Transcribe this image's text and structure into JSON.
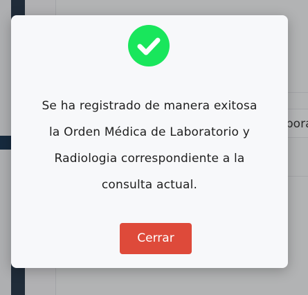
{
  "background": {
    "cell_text": "Laborator"
  },
  "dialog": {
    "icon": "check-circle-icon",
    "icon_color": "#19e65c",
    "message_lines": [
      "Se ha registrado de manera exitosa",
      "la Orden Médica de Laboratorio y",
      "Radiologia correspondiente a la",
      "consulta actual."
    ],
    "close_label": "Cerrar",
    "close_color": "#de4a3a"
  }
}
